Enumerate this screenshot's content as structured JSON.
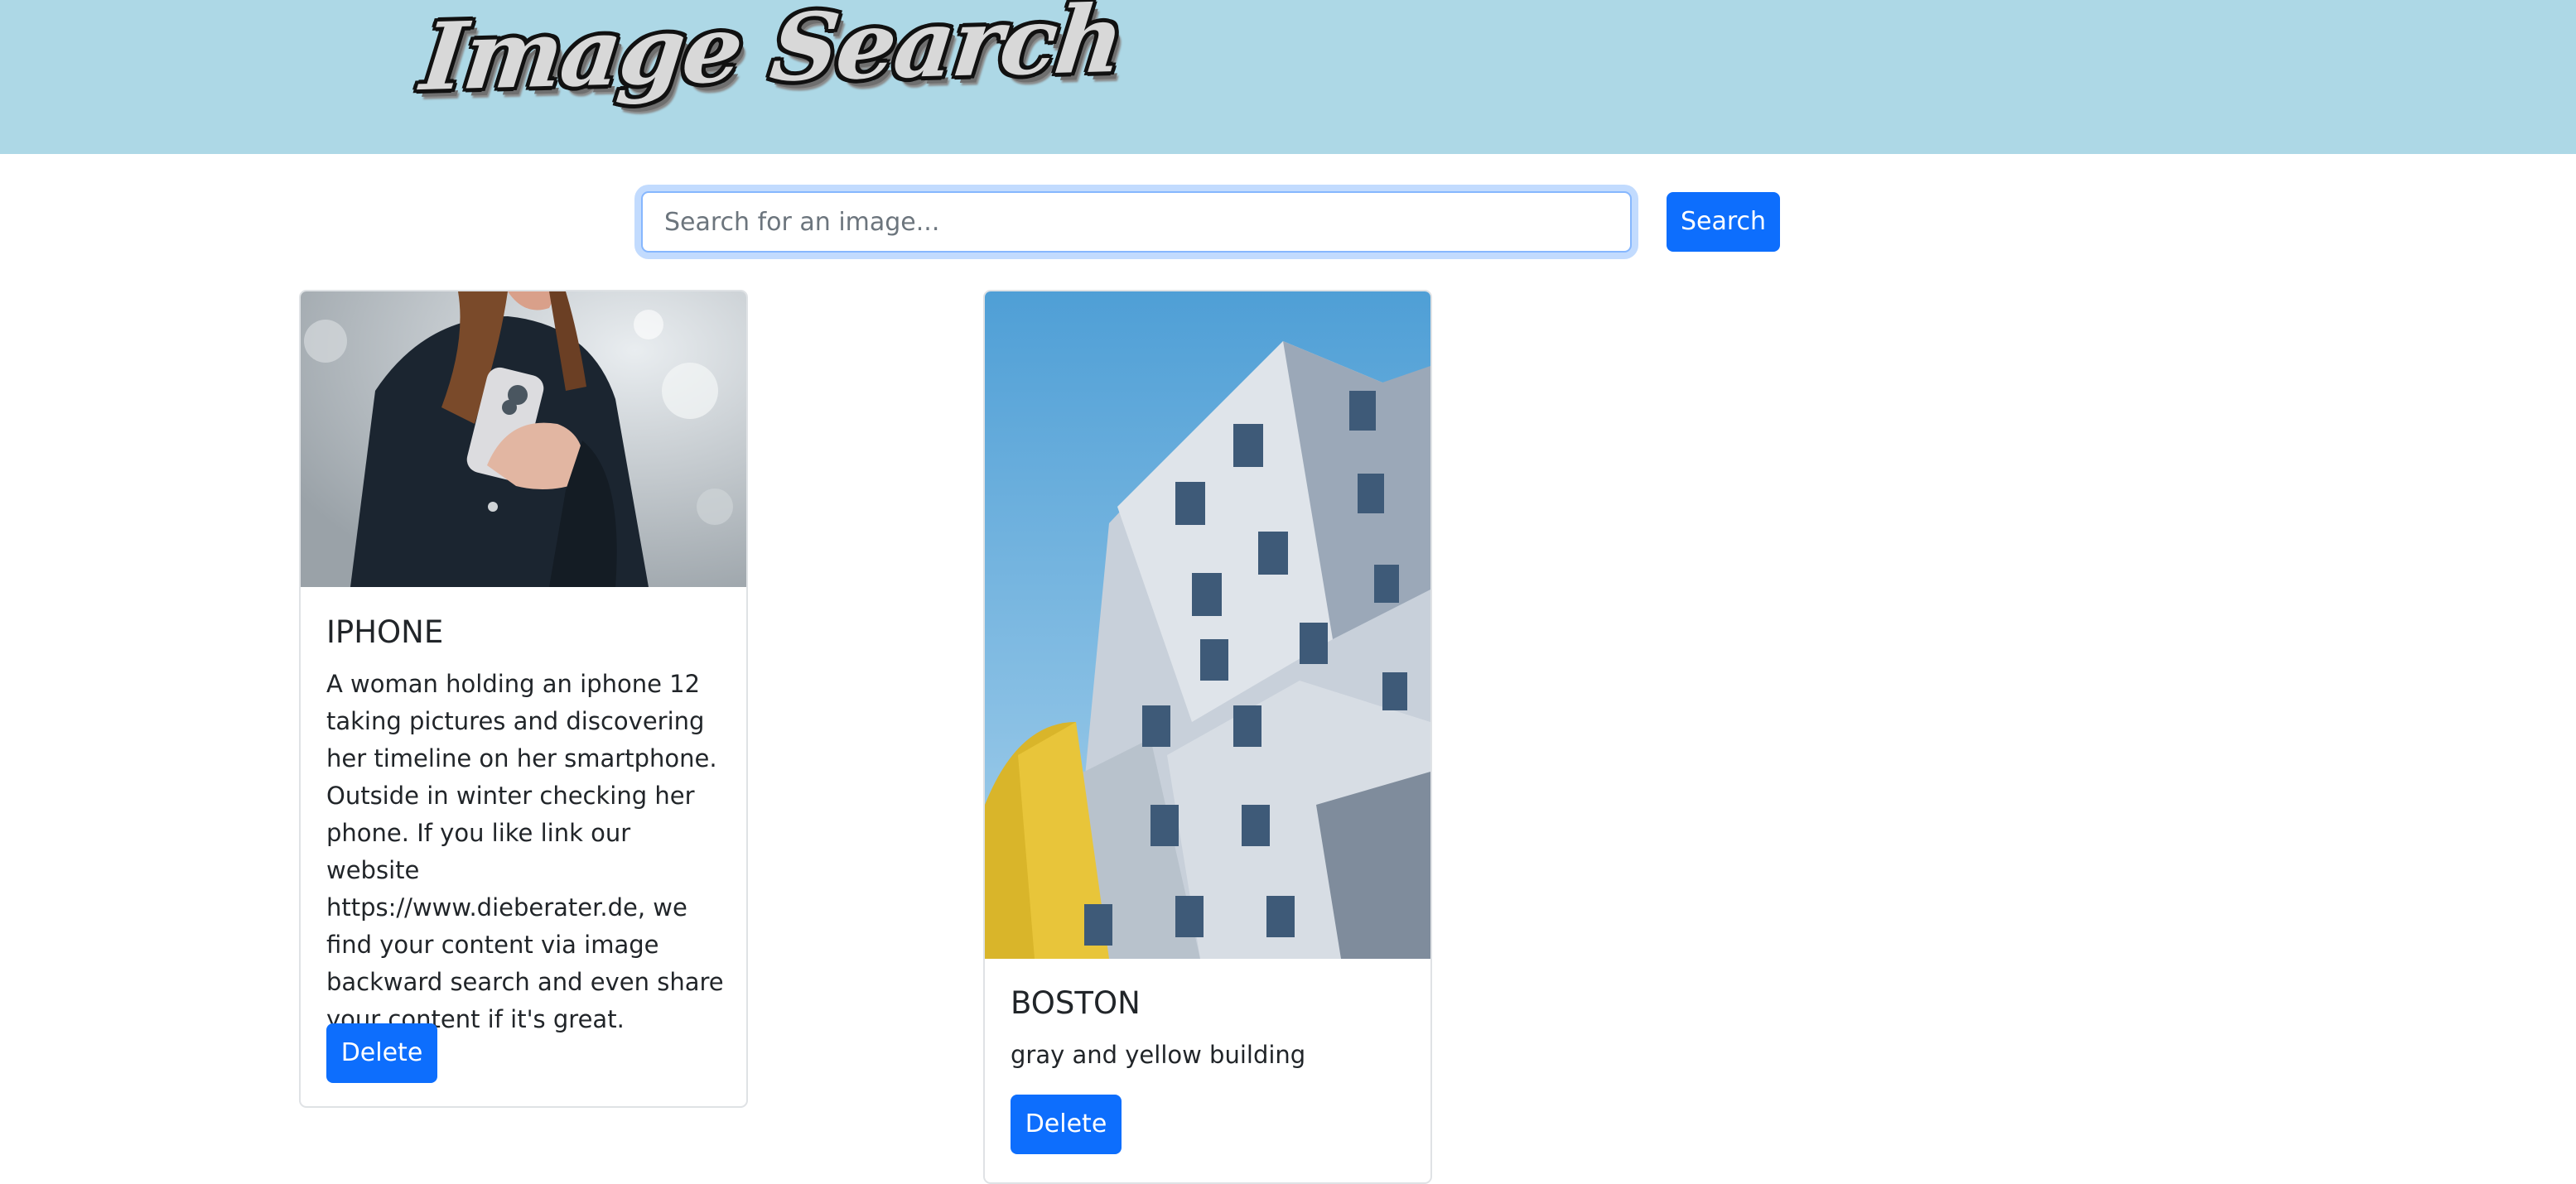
{
  "header": {
    "logo_text": "Image Search",
    "background_color": "#add8e6"
  },
  "search": {
    "placeholder": "Search for an image...",
    "value": "",
    "button_label": "Search"
  },
  "cards": [
    {
      "title": "IPHONE",
      "description": "A woman holding an iphone 12 taking pictures and discovering her timeline on her smartphone. Outside in winter checking her phone. If you like link our website https://www.dieberater.de, we find your content via image backward search and even share your content if it's great.",
      "delete_label": "Delete"
    },
    {
      "title": "BOSTON",
      "description": "gray and yellow building",
      "delete_label": "Delete"
    }
  ],
  "colors": {
    "primary": "#0d6efd",
    "focus_ring": "#86b7fe"
  }
}
